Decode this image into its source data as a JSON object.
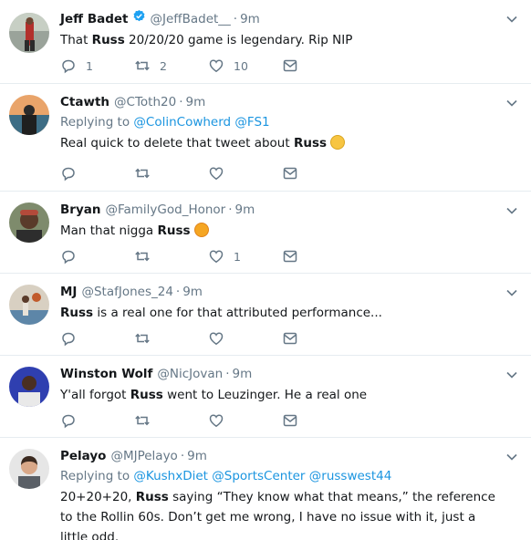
{
  "tweets": [
    {
      "name": "Jeff Badet",
      "handle": "@JeffBadet__",
      "time": "9m",
      "verified": true,
      "reply_prefix": "",
      "reply_to": [],
      "text_before": "That ",
      "text_bold": "Russ",
      "text_after": " 20/20/20 game is legendary. Rip NIP",
      "emoji": "",
      "counts": {
        "reply": "1",
        "retweet": "2",
        "like": "10"
      }
    },
    {
      "name": "Ctawth",
      "handle": "@CToth20",
      "time": "9m",
      "verified": false,
      "reply_prefix": "Replying to ",
      "reply_to": [
        "@ColinCowherd",
        "@FS1"
      ],
      "text_before": "Real quick to delete that tweet about ",
      "text_bold": "Russ",
      "text_after": "",
      "emoji": "face-with-monocle",
      "counts": {
        "reply": "",
        "retweet": "",
        "like": ""
      }
    },
    {
      "name": "Bryan",
      "handle": "@FamilyGod_Honor",
      "time": "9m",
      "verified": false,
      "reply_prefix": "",
      "reply_to": [],
      "text_before": "Man that nigga ",
      "text_bold": "Russ",
      "text_after": "",
      "emoji": "collision",
      "counts": {
        "reply": "",
        "retweet": "",
        "like": "1"
      }
    },
    {
      "name": "MJ",
      "handle": "@StafJones_24",
      "time": "9m",
      "verified": false,
      "reply_prefix": "",
      "reply_to": [],
      "text_before": "",
      "text_bold": "Russ",
      "text_after": " is a real one for that attributed performance...",
      "emoji": "",
      "counts": {
        "reply": "",
        "retweet": "",
        "like": ""
      }
    },
    {
      "name": "Winston Wolf",
      "handle": "@NicJovan",
      "time": "9m",
      "verified": false,
      "reply_prefix": "",
      "reply_to": [],
      "text_before": "Y'all forgot ",
      "text_bold": "Russ",
      "text_after": " went to Leuzinger.  He a real one",
      "emoji": "",
      "counts": {
        "reply": "",
        "retweet": "",
        "like": ""
      }
    },
    {
      "name": "Pelayo",
      "handle": "@MJPelayo",
      "time": "9m",
      "verified": false,
      "reply_prefix": "Replying to ",
      "reply_to": [
        "@KushxDiet",
        "@SportsCenter",
        "@russwest44"
      ],
      "text_before": "20+20+20, ",
      "text_bold": "Russ",
      "text_after": " saying “They know what that means,” the reference to the Rollin 60s.  Don’t get me wrong, I have no issue with it, just a little odd.",
      "emoji": "",
      "counts": {
        "reply": "",
        "retweet": "",
        "like": ""
      }
    }
  ],
  "colors": {
    "link": "#1b95e0",
    "muted": "#657786",
    "divider": "#e6ecf0",
    "verified": "#1da1f2"
  },
  "icons": {
    "reply": "reply-icon",
    "retweet": "retweet-icon",
    "like": "like-icon",
    "dm": "direct-message-icon",
    "menu": "chevron-down-icon"
  }
}
